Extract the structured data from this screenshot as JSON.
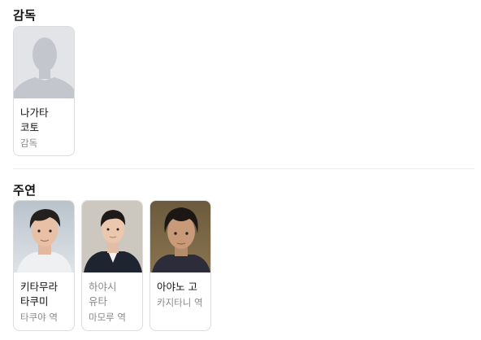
{
  "sections": {
    "director": {
      "title": "감독",
      "people": [
        {
          "name": "나가타 코토",
          "role": "감독",
          "photo": "default-avatar"
        }
      ]
    },
    "cast": {
      "title": "주연",
      "people": [
        {
          "name": "키타무라 타쿠미",
          "role": "타쿠야 역",
          "photo": "actor-portrait"
        },
        {
          "name": "하야시 유타",
          "role": "마모루 역",
          "photo": "actor-portrait"
        },
        {
          "name": "아야노 고",
          "role": "카지타니 역",
          "photo": "actor-portrait"
        }
      ]
    }
  },
  "colors": {
    "placeholder_bg": "#e3e4e7",
    "placeholder_figure": "#c3c6cc",
    "muted_text": "#8a8a8a",
    "border": "#dcdcdc"
  }
}
